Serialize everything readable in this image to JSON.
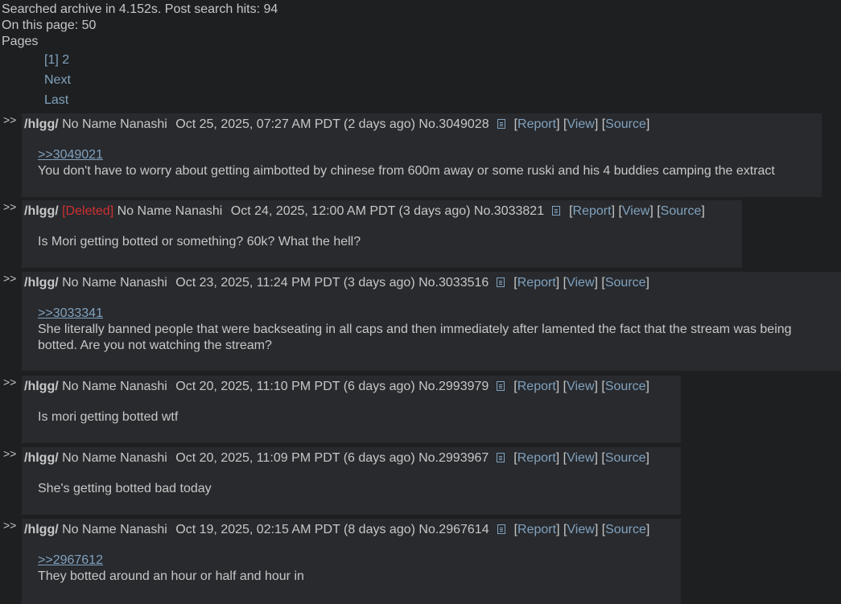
{
  "header": {
    "search_info": "Searched archive in 4.152s. Post search hits: 94",
    "on_page": "On this page: 50",
    "pages_label": "Pages"
  },
  "pagination": {
    "current": "[1]",
    "page2": "2",
    "next": "Next",
    "last": "Last"
  },
  "posts": [
    {
      "arrows": ">>",
      "board": "/hlgg/",
      "deleted": "",
      "name": "No Name Nanashi",
      "date": "Oct 25, 2025, 07:27 AM PDT (2 days ago)",
      "no": "No.3049028",
      "quote": ">>3049021",
      "text": "You don't have to worry about getting aimbotted by chinese from 600m away or some ruski and his 4 buddies camping the extract"
    },
    {
      "arrows": ">>",
      "board": "/hlgg/",
      "deleted": "[Deleted]",
      "name": "No Name Nanashi",
      "date": "Oct 24, 2025, 12:00 AM PDT (3 days ago)",
      "no": "No.3033821",
      "quote": "",
      "text": "Is Mori getting botted or something? 60k? What the hell?"
    },
    {
      "arrows": ">>",
      "board": "/hlgg/",
      "deleted": "",
      "name": "No Name Nanashi",
      "date": "Oct 23, 2025, 11:24 PM PDT (3 days ago)",
      "no": "No.3033516",
      "quote": ">>3033341",
      "text": "She literally banned people that were backseating in all caps and then immediately after lamented the fact that the stream was being botted. Are you not watching the stream?"
    },
    {
      "arrows": ">>",
      "board": "/hlgg/",
      "deleted": "",
      "name": "No Name Nanashi",
      "date": "Oct 20, 2025, 11:10 PM PDT (6 days ago)",
      "no": "No.2993979",
      "quote": "",
      "text": "Is mori getting botted wtf"
    },
    {
      "arrows": ">>",
      "board": "/hlgg/",
      "deleted": "",
      "name": "No Name Nanashi",
      "date": "Oct 20, 2025, 11:09 PM PDT (6 days ago)",
      "no": "No.2993967",
      "quote": "",
      "text": "She's getting botted bad today"
    },
    {
      "arrows": ">>",
      "board": "/hlgg/",
      "deleted": "",
      "name": "No Name Nanashi",
      "date": "Oct 19, 2025, 02:15 AM PDT (8 days ago)",
      "no": "No.2967614",
      "quote": ">>2967612",
      "text": "They botted around an hour or half and hour in"
    }
  ],
  "actions": {
    "report": "Report",
    "view": "View",
    "source": "Source"
  },
  "colors": {
    "background": "#1d1f21",
    "post_background": "#282a2e",
    "text": "#c5c8c6",
    "link": "#81a2be",
    "deleted": "#d03030"
  }
}
